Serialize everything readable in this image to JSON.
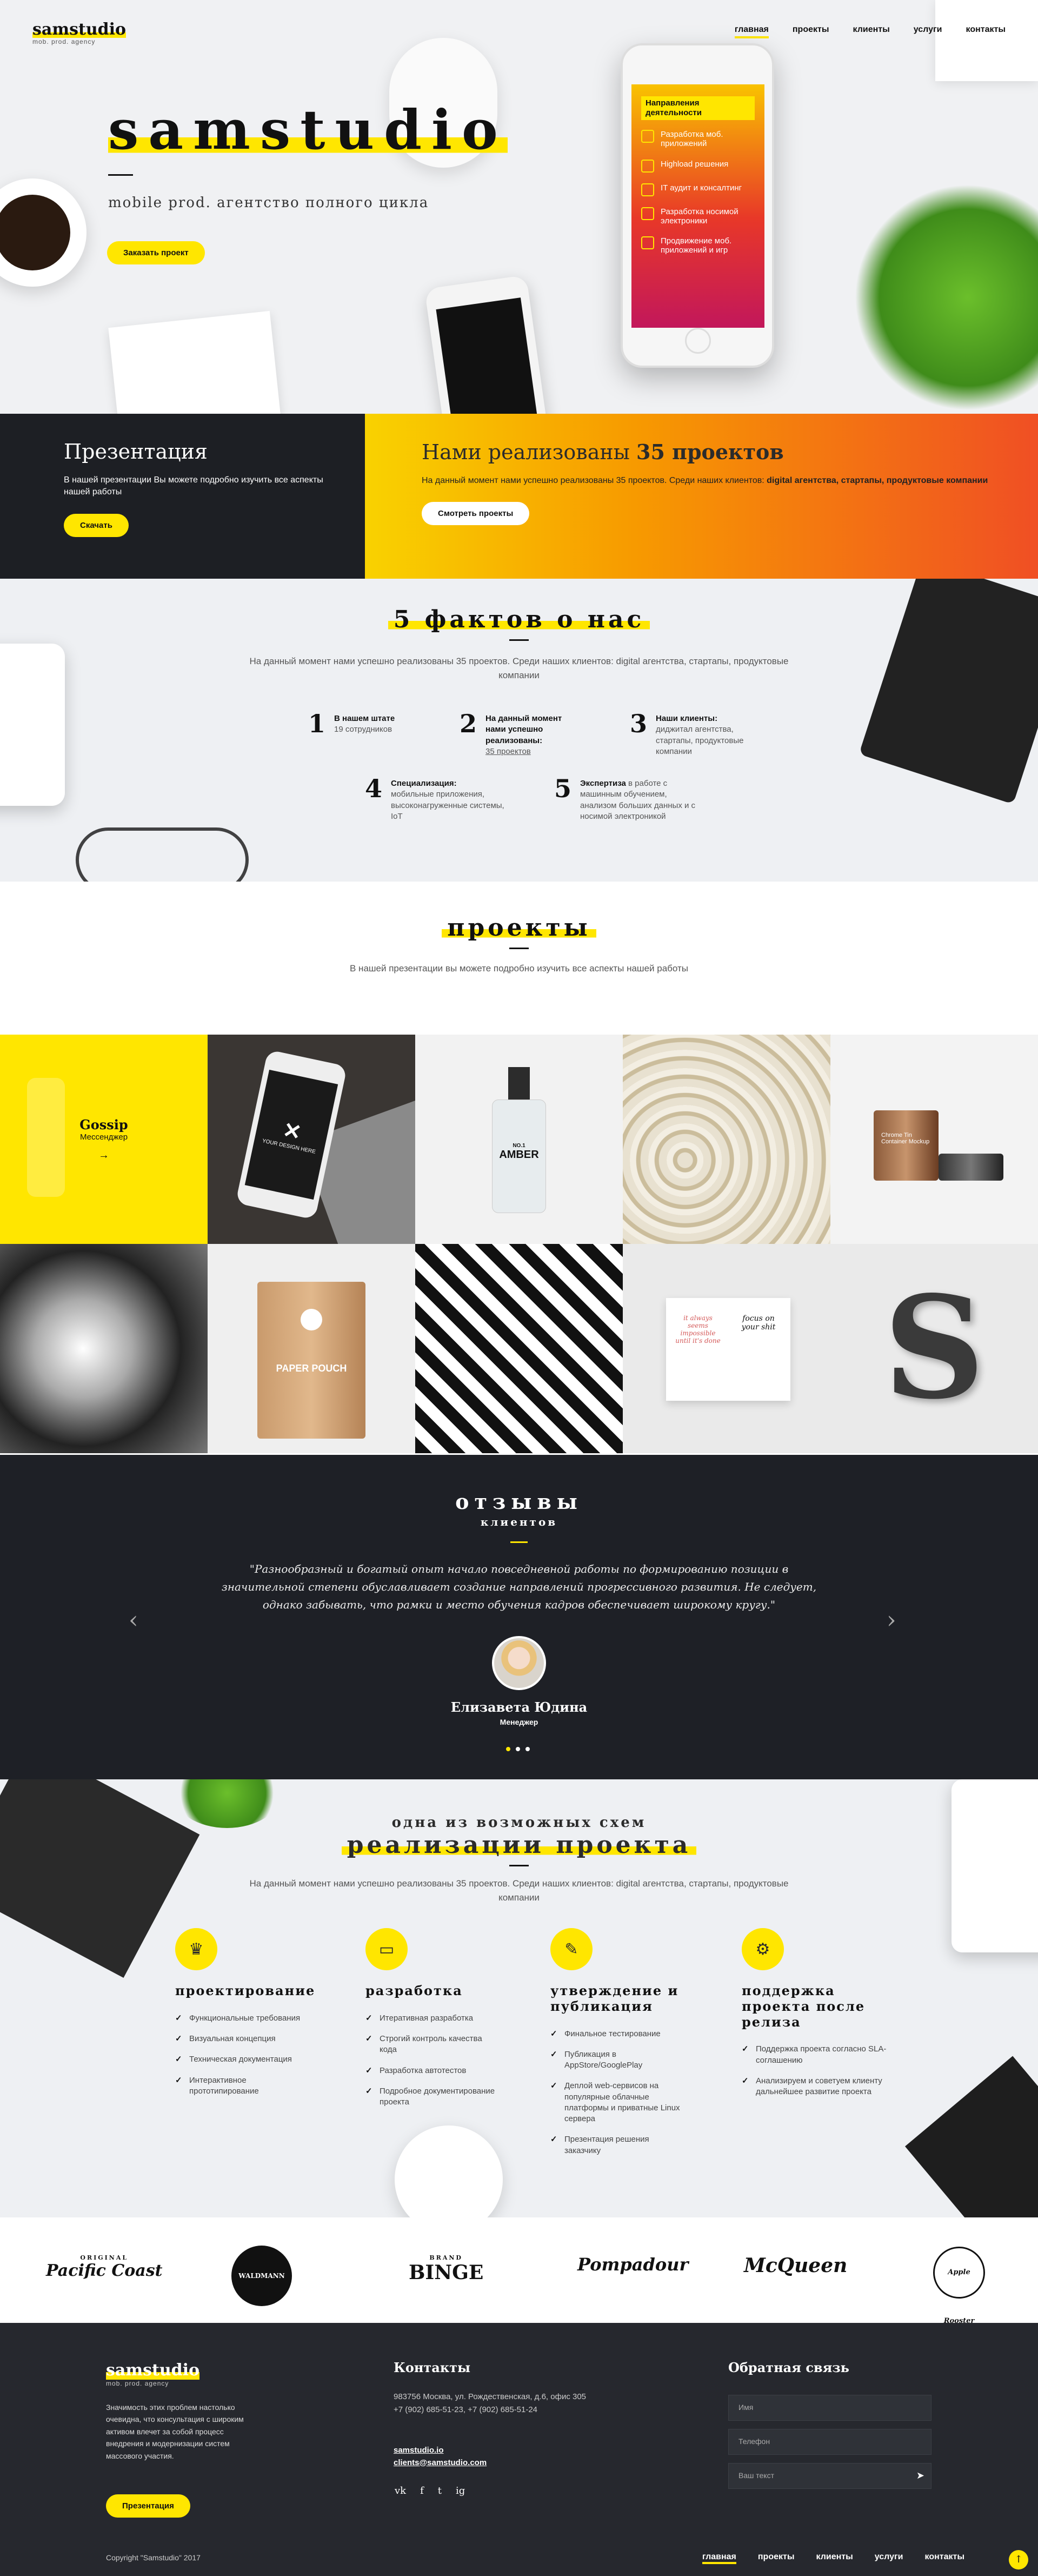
{
  "header": {
    "logo": "samstudio",
    "logo_sub": "mob. prod. agency",
    "nav": [
      "главная",
      "проекты",
      "клиенты",
      "услуги",
      "контакты"
    ]
  },
  "hero": {
    "title": "samstudio",
    "subtitle": "mobile prod. агентство полного цикла",
    "cta": "Заказать проект",
    "phone_heading": "Направления деятельности",
    "phone_items": [
      "Разработка моб. приложений",
      "Highload решения",
      "IT аудит и консалтинг",
      "Разработка носимой электроники",
      "Продвижение моб. приложений и игр"
    ]
  },
  "presentation": {
    "title": "Презентация",
    "text": "В нашей презентации Вы можете подробно изучить все аспекты нашей работы",
    "button": "Скачать"
  },
  "realized": {
    "title_pre": "Нами реализованы",
    "title_bold": "35 проектов",
    "text_pre": "На данный момент нами успешно реализованы 35 проектов. Среди наших клиентов:",
    "text_bold": "digital агентства, стартапы, продуктовые компании",
    "button": "Смотреть проекты"
  },
  "facts": {
    "title": "5 фактов о нас",
    "subtitle": "На данный момент нами успешно реализованы 35 проектов. Среди наших клиентов: digital агентства, стартапы, продуктовые компании",
    "items": [
      {
        "num": "1",
        "title": "В нашем штате",
        "text": "19 сотрудников"
      },
      {
        "num": "2",
        "title": "На данный момент нами успешно реализованы:",
        "text": "35 проектов"
      },
      {
        "num": "3",
        "title": "Наши клиенты:",
        "text": "диджитал агентства, стартапы, продуктовые компании"
      },
      {
        "num": "4",
        "title": "Специализация:",
        "text": "мобильные приложения, высоконагруженные системы, IoT"
      },
      {
        "num": "5",
        "title": "Экспертиза",
        "text": "в работе с машинным обучением, анализом больших данных и с носимой электроникой"
      }
    ]
  },
  "projects": {
    "title": "проекты",
    "subtitle": "В нашей презентации вы можете подробно изучить все аспекты нашей работы",
    "featured": {
      "title": "Gossip",
      "sub": "Мессенджер",
      "arrow": "→"
    },
    "tiles": [
      "iphone-mockup",
      "amber-bottle",
      "marble-texture",
      "chrome-tins",
      "ink-smoke",
      "paper-pouch",
      "geometric-pattern",
      "notebook-lettering",
      "balloon-s"
    ],
    "phone_text": "YOUR DESIGN HERE",
    "amber": "AMBER",
    "amber_no": "NO.1",
    "pouch": "PAPER POUCH",
    "tin": "Chrome Tin Container Mockup",
    "notebook": [
      "it always seems impossible until it's done",
      "focus on your shit"
    ],
    "balloon": "S"
  },
  "reviews": {
    "title": "отзывы",
    "subtitle": "клиентов",
    "quote": "\"Разнообразный и богатый опыт начало повседневной работы по формированию позиции в значительной степени обуславливает создание направлений прогрессивного развития. Не следует, однако забывать, что рамки и место обучения кадров обеспечивает широкому кругу.\"",
    "name": "Елизавета Юдина",
    "role": "Менеджер",
    "prev": "‹",
    "next": "›"
  },
  "scheme": {
    "pre": "одна из возможных схем",
    "title": "реализации проекта",
    "subtitle": "На данный момент нами успешно реализованы 35 проектов. Среди наших клиентов: digital агентства, стартапы, продуктовые компании",
    "cols": [
      {
        "icon": "♛",
        "title": "проектирование",
        "items": [
          "Функциональные требования",
          "Визуальная концепция",
          "Техническая документация",
          "Интерактивное прототипирование"
        ]
      },
      {
        "icon": "▭",
        "title": "разработка",
        "items": [
          "Итеративная разработка",
          "Строгий контроль качества кода",
          "Разработка автотестов",
          "Подробное документирование проекта"
        ]
      },
      {
        "icon": "✎",
        "title": "утверждение и публикация",
        "items": [
          "Финальное тестирование",
          "Публикация в AppStore/GooglePlay",
          "Деплой web-сервисов на популярные облачные платформы и приватные Linux сервера",
          "Презентация решения заказчику"
        ]
      },
      {
        "icon": "⚙",
        "title": "поддержка проекта после релиза",
        "items": [
          "Поддержка проекта согласно SLA-соглашению",
          "Анализируем и советуем клиенту дальнейшее развитие проекта"
        ]
      }
    ]
  },
  "clients": [
    "Pacific Coast",
    "WALDMANN",
    "BINGE",
    "Pompadour",
    "McQueen",
    "Apple Rooster"
  ],
  "clients_extra": {
    "c1_pre": "ORIGINAL",
    "c3_pre": "BRAND"
  },
  "footer": {
    "logo": "samstudio",
    "logo_sub": "mob. prod. agency",
    "about": "Значимость этих проблем настолько очевидна, что консультация с широким активом влечет за собой процесс внедрения и модернизации систем массового участия.",
    "btn": "Презентация",
    "contacts_title": "Контакты",
    "address": "983756 Москва, ул. Рождественская, д.6, офис 305",
    "phones": "+7 (902) 685-51-23,   +7 (902) 685-51-24",
    "site": "samstudio.io",
    "email": "clients@samstudio.com",
    "social": [
      "vk",
      "f",
      "t",
      "ig"
    ],
    "feedback_title": "Обратная связь",
    "fields": [
      "Имя",
      "Телефон",
      "Ваш текст"
    ],
    "copyright": "Copyright \"Samstudio\" 2017",
    "nav": [
      "главная",
      "проекты",
      "клиенты",
      "услуги",
      "контакты"
    ],
    "top": "↑"
  }
}
